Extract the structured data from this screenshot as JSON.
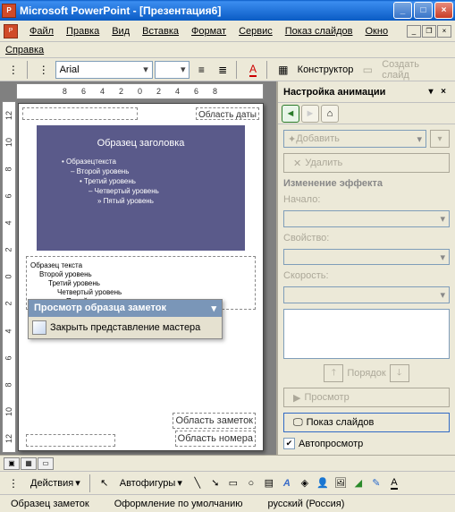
{
  "titlebar": {
    "app": "Microsoft PowerPoint",
    "doc": "[Презентация6]"
  },
  "menu": {
    "file": "Файл",
    "edit": "Правка",
    "view": "Вид",
    "insert": "Вставка",
    "format": "Формат",
    "tools": "Сервис",
    "slideshow": "Показ слайдов",
    "window": "Окно",
    "help": "Справка"
  },
  "toolbar": {
    "font": "Arial",
    "designer": "Конструктор",
    "new_slide": "Создать слайд"
  },
  "ruler_h": [
    "8",
    "6",
    "4",
    "2",
    "0",
    "2",
    "4",
    "6",
    "8"
  ],
  "ruler_v": [
    "12",
    "10",
    "8",
    "6",
    "4",
    "2",
    "0",
    "2",
    "4",
    "6",
    "8",
    "10",
    "12"
  ],
  "slide": {
    "date_area": "Область даты",
    "title": "Образец заголовка",
    "body_label": "Образецтекста",
    "lvl2": "– Второй уровень",
    "lvl3": "• Третий уровень",
    "lvl4": "– Четвертый уровень",
    "lvl5": "» Пятый уровень",
    "outline1": "Образец текста",
    "outline2": "Второй уровень",
    "outline3": "Третий уровень",
    "outline4": "Четвертый уровень",
    "outline5": "Пятый уровень",
    "notes_area": "Область заметок",
    "number_area": "Область номера"
  },
  "floating": {
    "title": "Просмотр образца заметок",
    "close": "Закрыть представление мастера"
  },
  "pane": {
    "title": "Настройка анимации",
    "add": "Добавить",
    "remove": "Удалить",
    "change_section": "Изменение эффекта",
    "start": "Начало:",
    "property": "Свойство:",
    "speed": "Скорость:",
    "order": "Порядок",
    "preview": "Просмотр",
    "slideshow": "Показ слайдов",
    "autopreview": "Автопросмотр"
  },
  "draw": {
    "actions": "Действия",
    "autoshapes": "Автофигуры"
  },
  "status": {
    "master": "Образец заметок",
    "design": "Оформление по умолчанию",
    "lang": "русский (Россия)"
  }
}
